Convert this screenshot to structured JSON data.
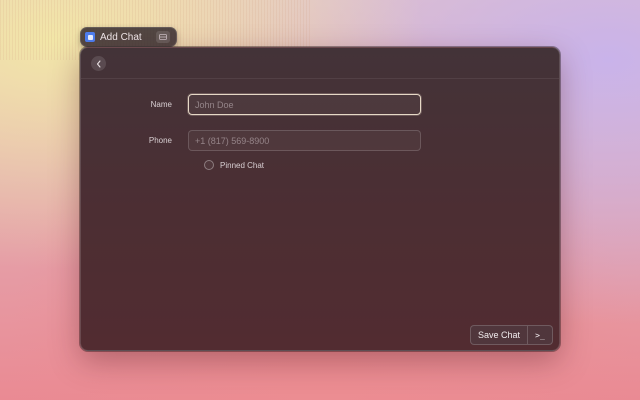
{
  "window": {
    "title": "Add Chat"
  },
  "form": {
    "name": {
      "label": "Name",
      "value": "",
      "placeholder": "John Doe"
    },
    "phone": {
      "label": "Phone",
      "value": "",
      "placeholder": "+1 (817) 569-8900"
    },
    "pinned": {
      "label": "Pinned Chat",
      "checked": false
    }
  },
  "footer": {
    "save_label": "Save Chat",
    "terminal_label": ">_"
  },
  "icons": {
    "app": "app-icon",
    "collapse": "collapse-icon",
    "back": "chevron-left-icon"
  },
  "colors": {
    "app_icon_blue": "#4d7ef0",
    "focus_border": "#e6d8c6"
  }
}
